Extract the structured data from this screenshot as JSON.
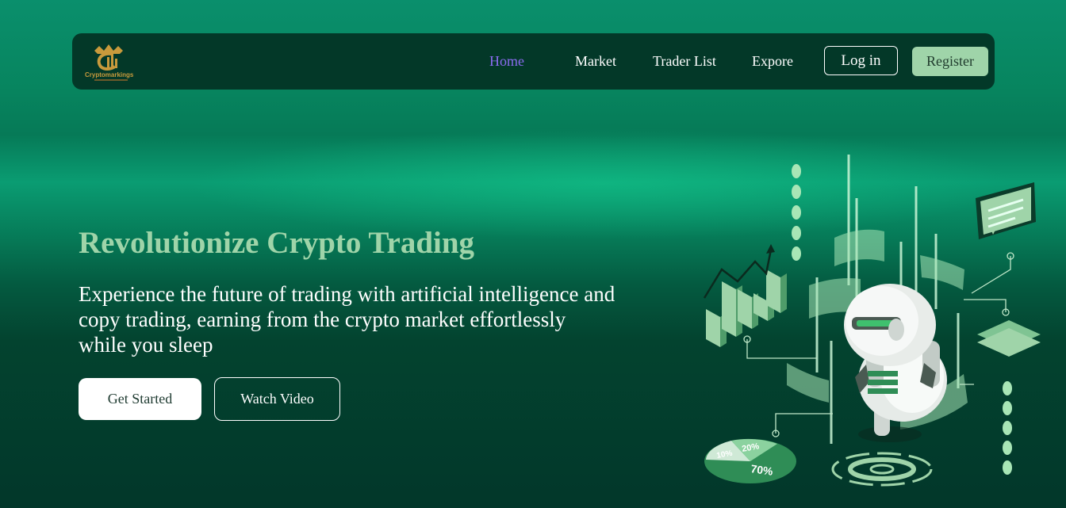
{
  "brand": {
    "name": "Cryptomarkings",
    "colors": {
      "gold": "#c89a3c",
      "accent": "#9fd4a9",
      "active_link": "#8b6cf0",
      "nav_bg": "#033828"
    }
  },
  "nav": {
    "links": [
      "Home",
      "Market",
      "Trader List",
      "Expore"
    ],
    "active": "Home",
    "login_label": "Log in",
    "register_label": "Register"
  },
  "hero": {
    "title": "Revolutionize Crypto Trading",
    "subtitle": "Experience the future of trading with artificial intelligence and copy trading, earning from the crypto market effortlessly while you sleep",
    "primary_cta": "Get Started",
    "secondary_cta": "Watch Video"
  },
  "illustration": {
    "icons": [
      "ai-robot-icon",
      "bar-chart-icon",
      "chat-bubble-icon",
      "pie-chart-icon"
    ],
    "pie_labels": [
      "10%",
      "20%",
      "70%"
    ]
  }
}
